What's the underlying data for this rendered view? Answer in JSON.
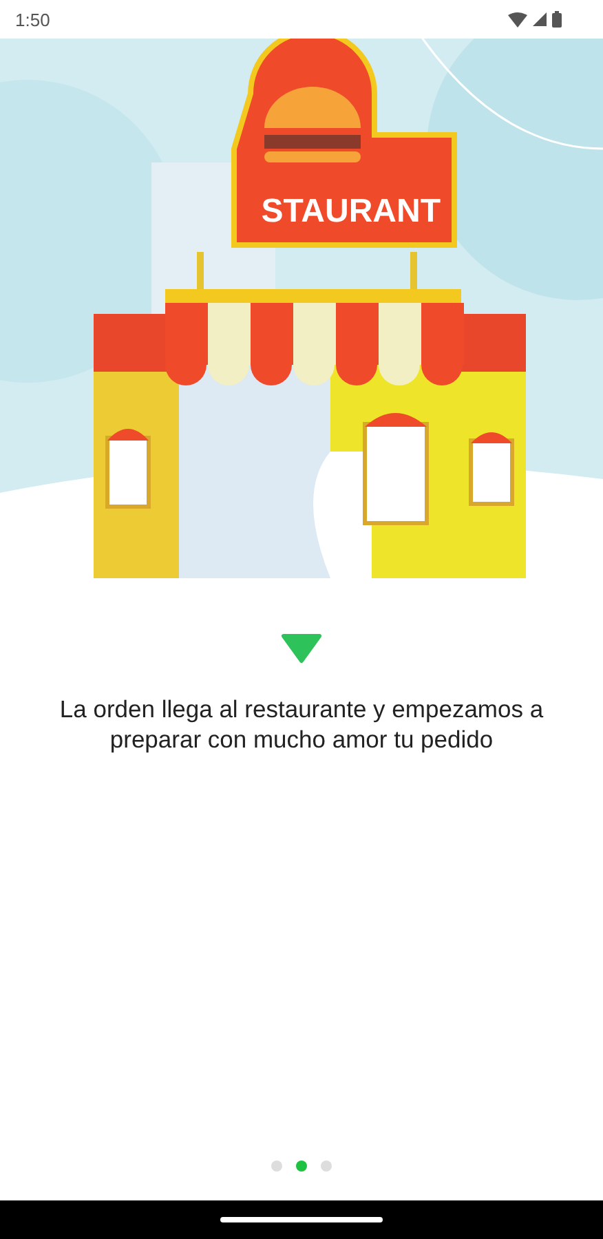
{
  "status_bar": {
    "time": "1:50"
  },
  "illustration": {
    "sign_text": "STAURANT"
  },
  "caption": "La orden llega al restaurante y empezamos a preparar con mucho amor tu pedido",
  "pager": [
    {
      "selected": false
    },
    {
      "selected": true
    },
    {
      "selected": false
    }
  ]
}
